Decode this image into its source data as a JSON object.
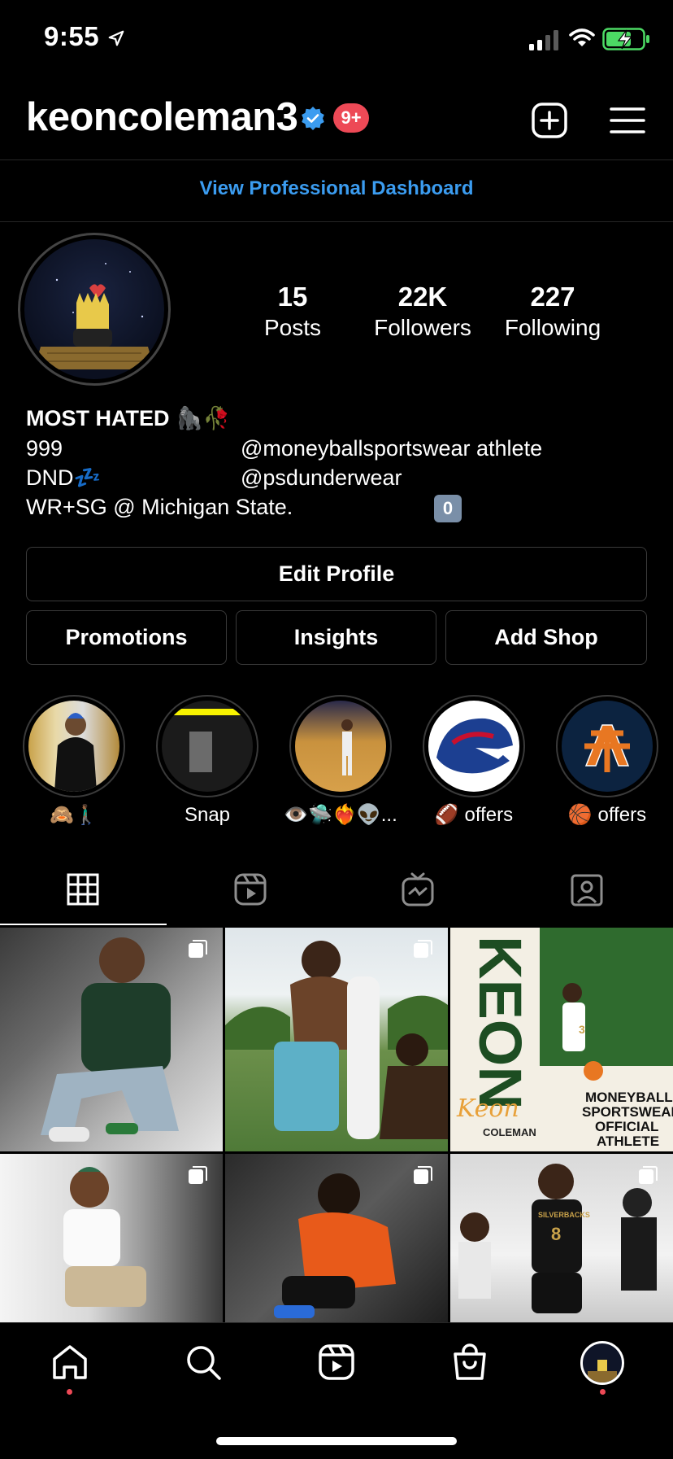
{
  "status_bar": {
    "time": "9:55"
  },
  "header": {
    "username": "keoncoleman3",
    "notification_badge": "9+",
    "accent_blue": "#3b9cf0",
    "badge_red": "#ed4956"
  },
  "dashboard_link": "View Professional Dashboard",
  "stats": [
    {
      "value": "15",
      "label": "Posts"
    },
    {
      "value": "22K",
      "label": "Followers"
    },
    {
      "value": "227",
      "label": "Following"
    }
  ],
  "bio": {
    "name": "MOST HATED 🦍🥀",
    "line1_left": "999",
    "line1_right": "@moneyballsportswear athlete",
    "line2_left": "DND💤",
    "line2_right": "@psdunderwear",
    "line3_left": "WR+SG @ Michigan State.",
    "badge": "0"
  },
  "buttons": {
    "edit_profile": "Edit Profile",
    "promotions": "Promotions",
    "insights": "Insights",
    "add_shop": "Add Shop"
  },
  "highlights": [
    {
      "label": "🙈🚶🏾‍♂️"
    },
    {
      "label": "Snap"
    },
    {
      "label": "👁️🛸❤️‍🔥👽..."
    },
    {
      "label": "🏈 offers"
    },
    {
      "label": "🏀 offers"
    }
  ],
  "tabs": [
    {
      "icon": "grid-icon"
    },
    {
      "icon": "reels-icon"
    },
    {
      "icon": "igtv-icon"
    },
    {
      "icon": "tagged-icon"
    }
  ],
  "posts": [
    {
      "description": "post-1",
      "multi": true
    },
    {
      "description": "post-2",
      "multi": true
    },
    {
      "description": "post-3",
      "multi": false
    },
    {
      "description": "post-4",
      "multi": true
    },
    {
      "description": "post-5",
      "multi": true
    },
    {
      "description": "post-6",
      "multi": true
    }
  ],
  "post_text": {
    "keon_big": "KEON",
    "keon_script": "Keon",
    "coleman": "COLEMAN",
    "moneyball_lines": [
      "MONEYBALL",
      "SPORTSWEAR",
      "OFFICIAL",
      "ATHLETE"
    ],
    "jersey_number": "3",
    "silverbacks": "SILVERBACKS",
    "silverbacks_number": "8"
  },
  "bottom_nav": [
    {
      "icon": "home-icon"
    },
    {
      "icon": "search-icon"
    },
    {
      "icon": "reels-nav-icon"
    },
    {
      "icon": "shop-icon"
    },
    {
      "icon": "profile-avatar"
    }
  ]
}
